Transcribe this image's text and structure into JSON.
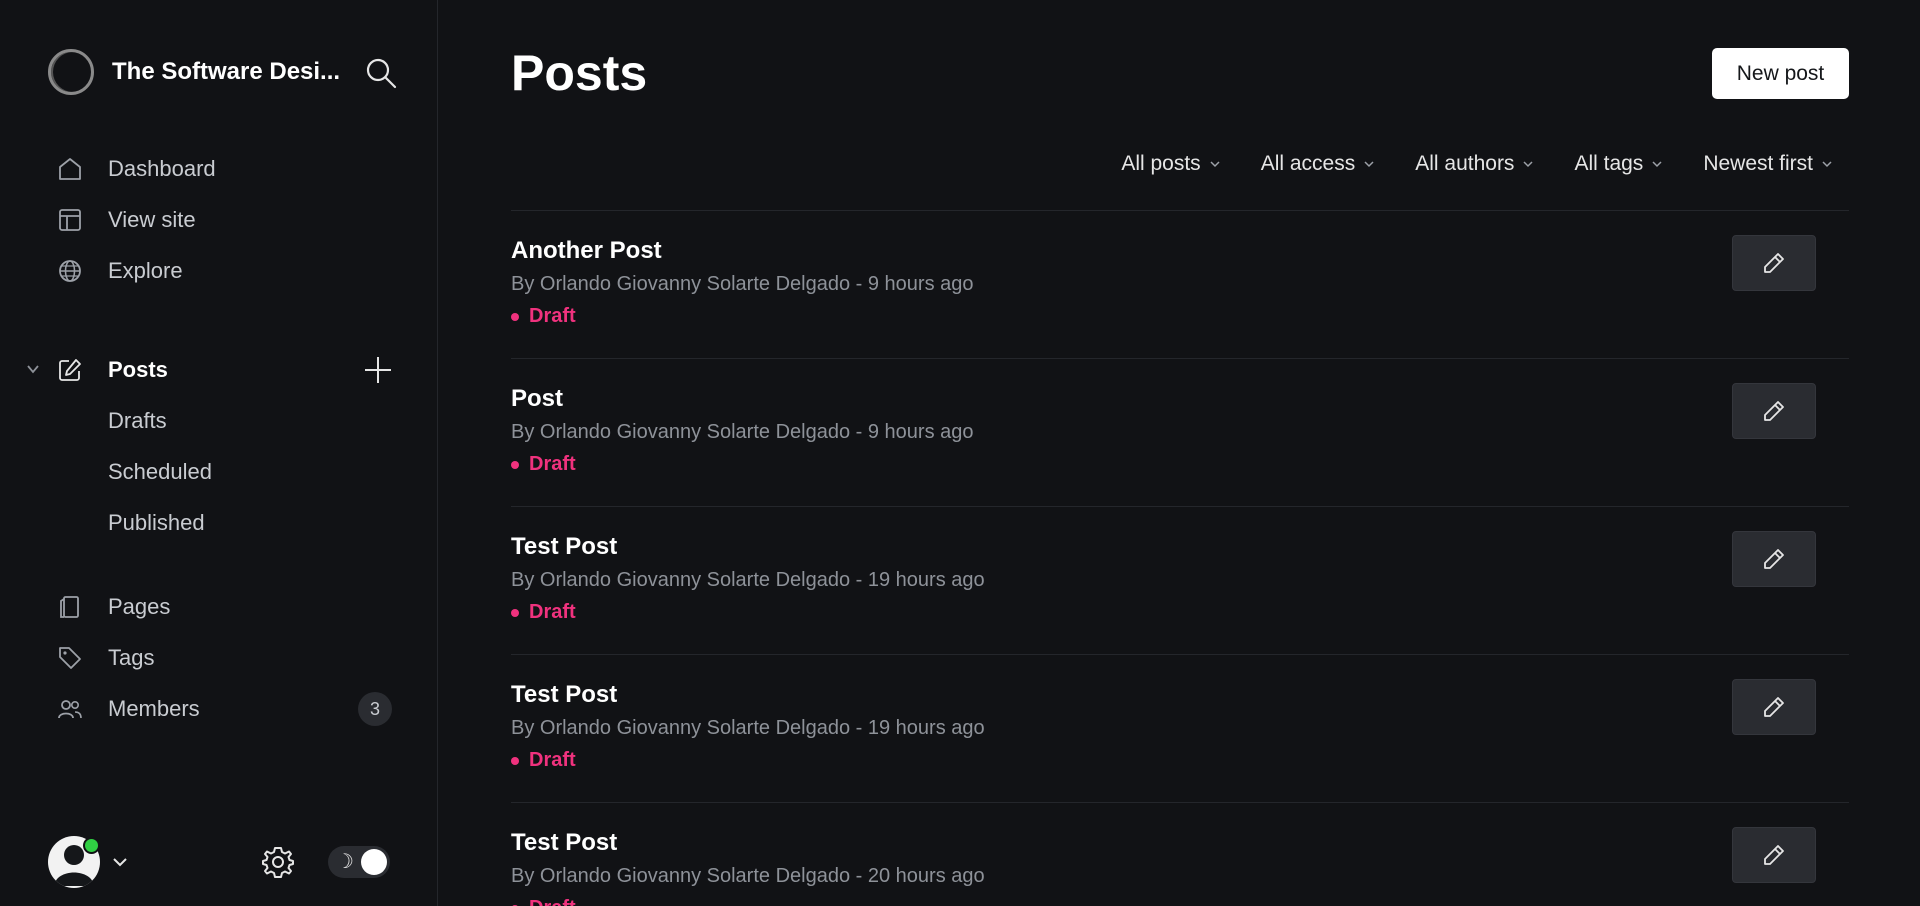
{
  "sidebar": {
    "site_title": "The Software Desi...",
    "nav_top": [
      {
        "label": "Dashboard",
        "icon": "home-icon"
      },
      {
        "label": "View site",
        "icon": "layout-icon"
      },
      {
        "label": "Explore",
        "icon": "globe-icon"
      }
    ],
    "posts": {
      "label": "Posts",
      "subitems": [
        "Drafts",
        "Scheduled",
        "Published"
      ]
    },
    "nav_bottom": [
      {
        "label": "Pages",
        "icon": "pages-icon"
      },
      {
        "label": "Tags",
        "icon": "tag-icon"
      },
      {
        "label": "Members",
        "icon": "members-icon",
        "badge": "3"
      }
    ],
    "theme_toggle_icon": "☽"
  },
  "main": {
    "title": "Posts",
    "new_post_label": "New post",
    "filters": [
      "All posts",
      "All access",
      "All authors",
      "All tags",
      "Newest first"
    ],
    "posts": [
      {
        "title": "Another Post",
        "meta": "By Orlando Giovanny Solarte Delgado - 9 hours ago",
        "status": "Draft"
      },
      {
        "title": "Post",
        "meta": "By Orlando Giovanny Solarte Delgado - 9 hours ago",
        "status": "Draft"
      },
      {
        "title": "Test Post",
        "meta": "By Orlando Giovanny Solarte Delgado - 19 hours ago",
        "status": "Draft"
      },
      {
        "title": "Test Post",
        "meta": "By Orlando Giovanny Solarte Delgado - 19 hours ago",
        "status": "Draft"
      },
      {
        "title": "Test Post",
        "meta": "By Orlando Giovanny Solarte Delgado - 20 hours ago",
        "status": "Draft"
      }
    ]
  },
  "colors": {
    "background": "#111215",
    "draft": "#f0327e",
    "online": "#30cf43"
  }
}
